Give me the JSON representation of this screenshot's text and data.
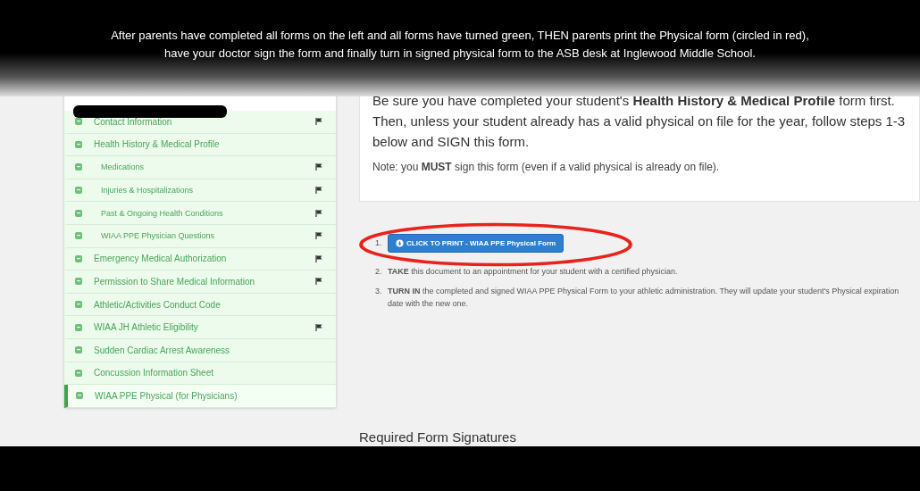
{
  "overlay_note": "After parents have completed all forms on the left and all forms have turned green, THEN parents print the Physical form (circled in red), have your doctor sign the form and finally turn in signed physical form to the ASB desk at Inglewood Middle School.",
  "sidebar": {
    "items": [
      {
        "label": "Contact Information",
        "flagged": true,
        "selected": false
      },
      {
        "label": "Health History & Medical Profile",
        "flagged": false,
        "selected": false,
        "children": [
          {
            "label": "Medications",
            "flagged": true,
            "selected": false
          },
          {
            "label": "Injuries & Hospitalizations",
            "flagged": true,
            "selected": false
          },
          {
            "label": "Past & Ongoing Health Conditions",
            "flagged": true,
            "selected": false
          },
          {
            "label": "WIAA PPE Physician Questions",
            "flagged": true,
            "selected": false
          }
        ]
      },
      {
        "label": "Emergency Medical Authorization",
        "flagged": true,
        "selected": false
      },
      {
        "label": "Permission to Share Medical Information",
        "flagged": true,
        "selected": false
      },
      {
        "label": "Athletic/Activities Conduct Code",
        "flagged": false,
        "selected": false
      },
      {
        "label": "WIAA JH Athletic Eligibility",
        "flagged": true,
        "selected": false
      },
      {
        "label": "Sudden Cardiac Arrest Awareness",
        "flagged": false,
        "selected": false
      },
      {
        "label": "Concussion Information Sheet",
        "flagged": false,
        "selected": false
      },
      {
        "label": "WIAA PPE Physical (for Physicians)",
        "flagged": false,
        "selected": true
      }
    ]
  },
  "notice": {
    "intro": "Be sure you have completed your student's **Health History & Medical Profile** form first. Then, unless your student already has a valid physical on file for the year, follow steps 1-3 below and SIGN this form.",
    "note": "Note: you **MUST** sign this form (even if a valid physical is already on file)."
  },
  "steps": [
    {
      "number": "1.",
      "kind": "button",
      "button": "CLICK TO PRINT - WIAA PPE Physical Form",
      "circled": true
    },
    {
      "number": "2.",
      "kind": "text",
      "text": "**TAKE** this document to an appointment for your student with a certified physician."
    },
    {
      "number": "3.",
      "kind": "text",
      "text": "**TURN IN** the completed and signed WIAA PPE Physical Form to your athletic administration. They will update your student's Physical expiration date with the new one."
    }
  ],
  "signatures_heading": "Required Form Signatures"
}
